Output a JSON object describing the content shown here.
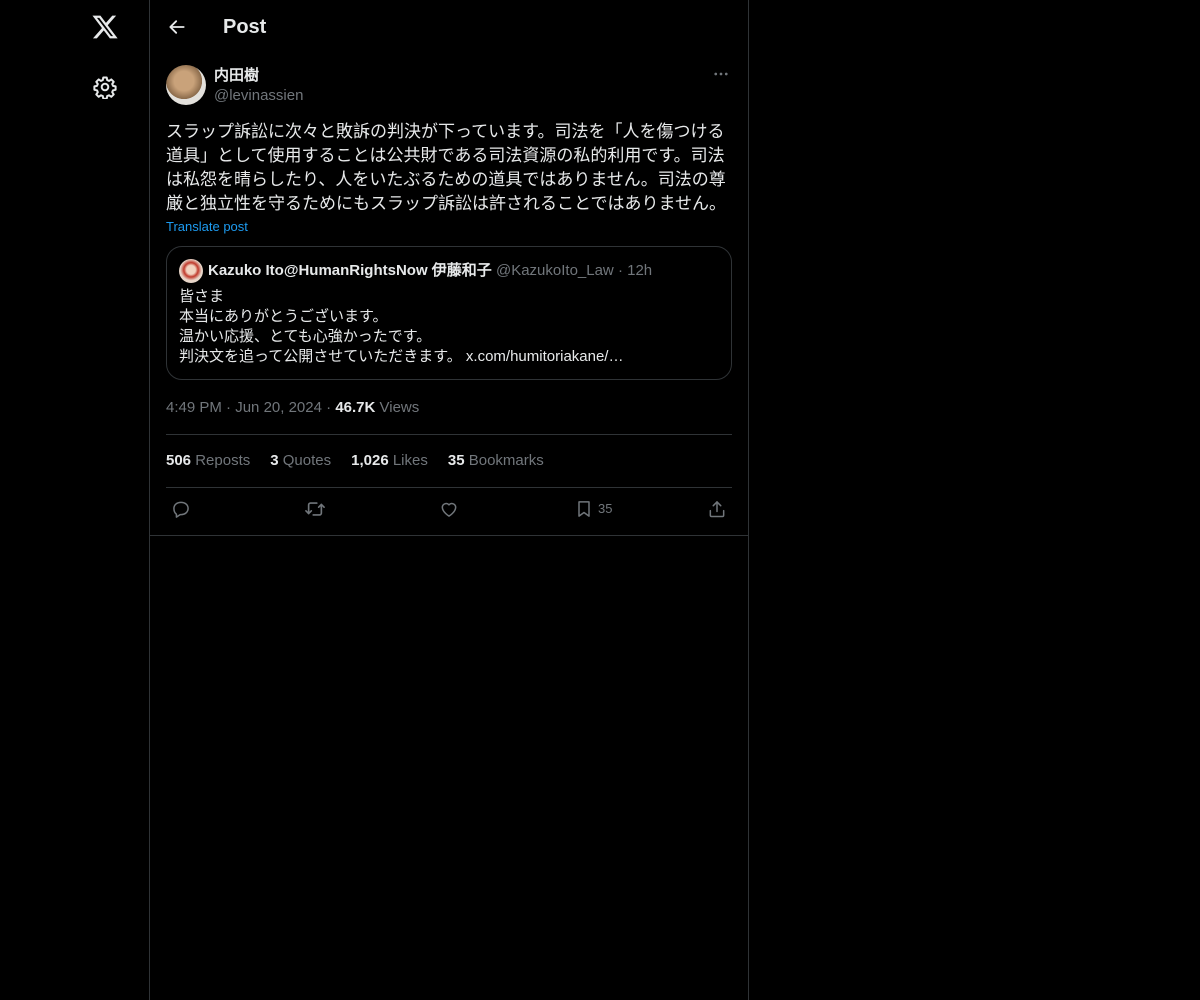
{
  "header": {
    "title": "Post"
  },
  "post": {
    "author_name": "内田樹",
    "author_handle": "@levinassien",
    "text": "スラップ訴訟に次々と敗訴の判決が下っています。司法を「人を傷つける道具」として使用することは公共財である司法資源の私的利用です。司法は私怨を晴らしたり、人をいたぶるための道具ではありません。司法の尊厳と独立性を守るためにもスラップ訴訟は許されることではありません。",
    "translate_label": "Translate post",
    "quote": {
      "author_name": "Kazuko Ito@HumanRightsNow 伊藤和子",
      "author_handle": "@KazukoIto_Law",
      "separator": "·",
      "time": "12h",
      "lines": [
        "皆さま",
        "本当にありがとうございます。",
        "温かい応援、とても心強かったです。",
        "判決文を追って公開させていただきます。 x.com/humitoriakane/…"
      ]
    },
    "meta": {
      "time": "4:49 PM",
      "separator": "·",
      "date": "Jun 20, 2024",
      "views_count": "46.7K",
      "views_label": "Views"
    },
    "stats": {
      "reposts_count": "506",
      "reposts_label": "Reposts",
      "quotes_count": "3",
      "quotes_label": "Quotes",
      "likes_count": "1,026",
      "likes_label": "Likes",
      "bookmarks_count": "35",
      "bookmarks_label": "Bookmarks"
    },
    "actions": {
      "bookmark_count": "35"
    }
  },
  "icons": {
    "logo": "x-logo-icon",
    "settings": "gear-icon",
    "back": "arrow-left-icon",
    "more": "more-horizontal-icon",
    "reply": "reply-icon",
    "repost": "repost-icon",
    "like": "heart-icon",
    "bookmark": "bookmark-icon",
    "share": "share-icon"
  },
  "colors": {
    "background": "#000000",
    "text_primary": "#e7e9ea",
    "text_secondary": "#71767b",
    "link": "#1d9bf0",
    "border": "#2f3336"
  }
}
